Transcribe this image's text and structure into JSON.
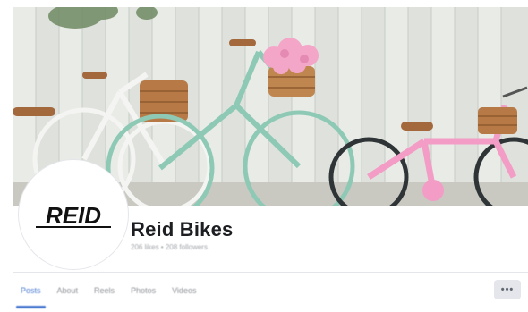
{
  "page": {
    "name": "Reid Bikes",
    "stats": "206 likes • 208 followers",
    "logo_text": "REID"
  },
  "tabs": [
    {
      "label": "Posts",
      "active": true
    },
    {
      "label": "About",
      "active": false
    },
    {
      "label": "Reels",
      "active": false
    },
    {
      "label": "Photos",
      "active": false
    },
    {
      "label": "Videos",
      "active": false
    }
  ],
  "more_button": {
    "icon": "more-icon",
    "label": "•••"
  },
  "colors": {
    "accent": "#4c7bd1",
    "bike_mint": "#8ec9b6",
    "bike_white": "#f4f5f2",
    "bike_pink": "#f29cc6",
    "flowers": "#f4a6c8",
    "basket": "#b77945"
  }
}
